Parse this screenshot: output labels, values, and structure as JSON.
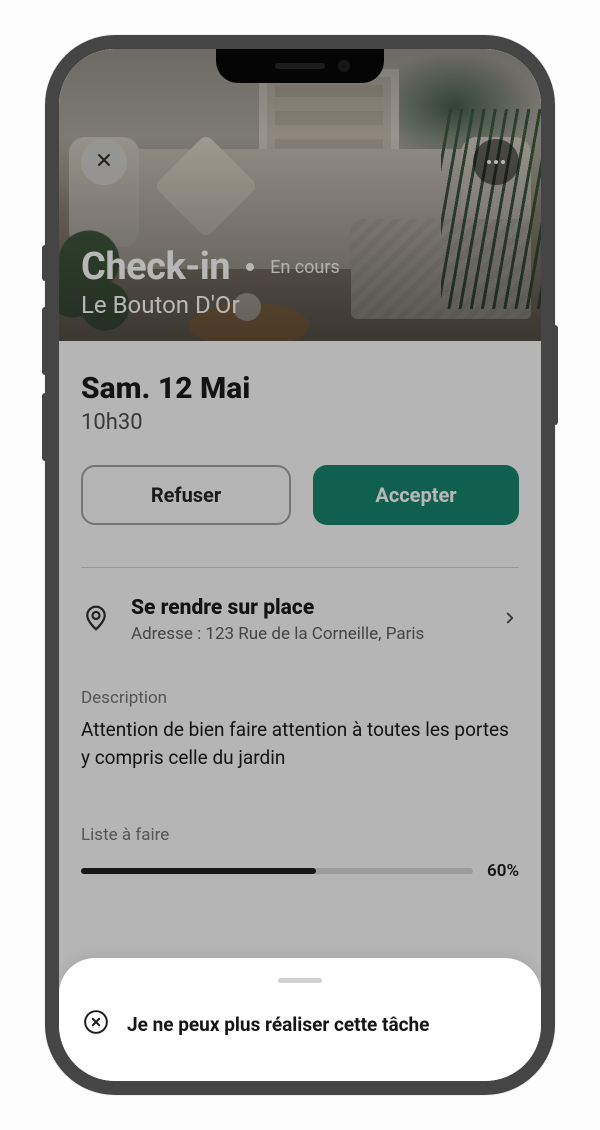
{
  "hero": {
    "title": "Check-in",
    "status": "En cours",
    "subtitle": "Le Bouton D'Or"
  },
  "schedule": {
    "date": "Sam. 12 Mai",
    "time": "10h30"
  },
  "actions": {
    "refuse": "Refuser",
    "accept": "Accepter"
  },
  "location": {
    "title": "Se rendre sur place",
    "address_label": "Adresse :",
    "address_value": "123 Rue de la Corneille, Paris"
  },
  "description": {
    "label": "Description",
    "text": "Attention de bien faire attention à toutes les portes y compris celle du jardin"
  },
  "todo": {
    "label": "Liste à faire",
    "percent": 60,
    "percent_label": "60%"
  },
  "sheet": {
    "cancel": "Je ne peux plus réaliser cette tâche"
  },
  "colors": {
    "primary": "#12836b"
  }
}
